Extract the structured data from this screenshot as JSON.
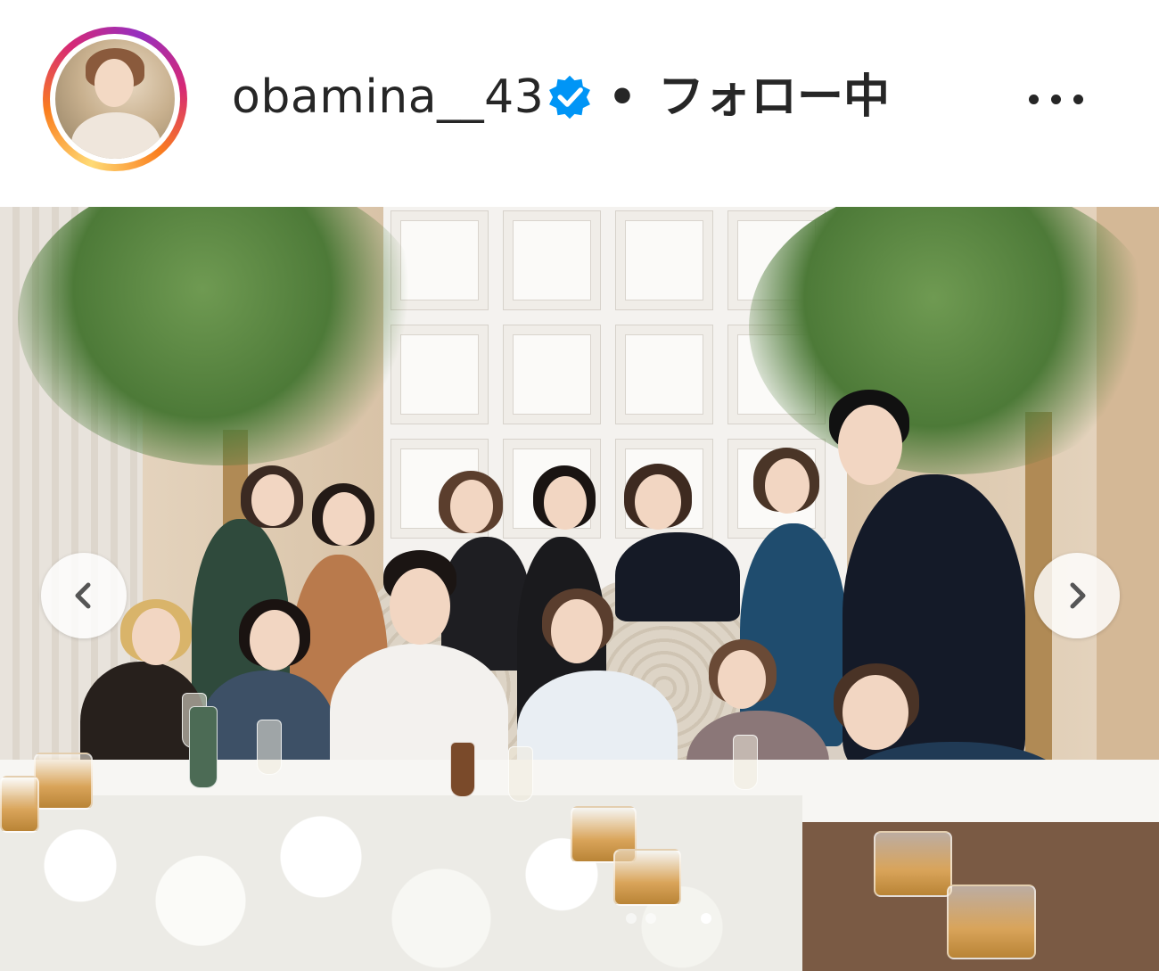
{
  "post": {
    "username": "obamina__43",
    "separator": "•",
    "follow_status": "フォロー中",
    "verified": true,
    "icons": {
      "verified": "verified-badge-icon",
      "more": "more-options-icon",
      "prev": "chevron-left-icon",
      "next": "chevron-right-icon"
    },
    "colors": {
      "verified_blue": "#0095f6",
      "text": "#262626"
    }
  },
  "carousel": {
    "slide_count": 4,
    "active_index": 2
  }
}
